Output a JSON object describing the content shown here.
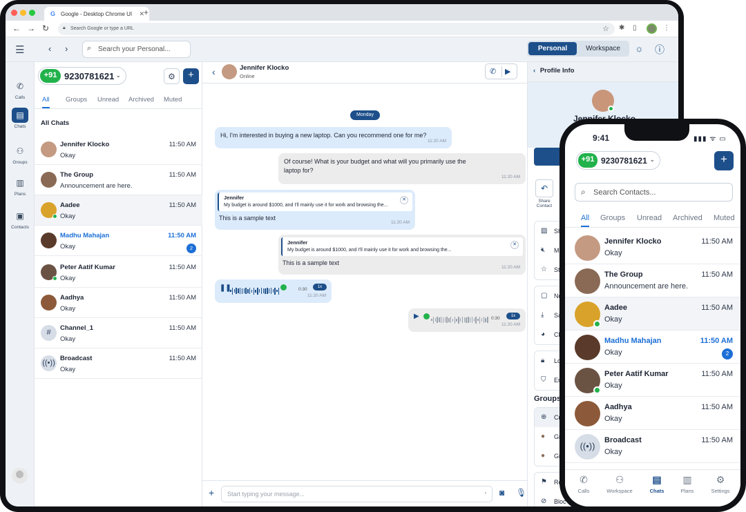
{
  "browser": {
    "tab_title": "Google - Desktop Chrome UI",
    "tab_icon": "G",
    "url_placeholder": "Search Google or type a URL"
  },
  "header": {
    "search_placeholder": "Search your Personal...",
    "toggle": [
      "Personal",
      "Workspace"
    ],
    "active_toggle": "Personal"
  },
  "rail": [
    {
      "label": "Calls",
      "icon": "phone-icon"
    },
    {
      "label": "Chats",
      "icon": "chat-icon"
    },
    {
      "label": "Groups",
      "icon": "groups-icon"
    },
    {
      "label": "Plans",
      "icon": "plans-icon"
    },
    {
      "label": "Contacts",
      "icon": "contacts-icon"
    }
  ],
  "account": {
    "country_code": "+91",
    "number": "9230781621"
  },
  "list_tabs": [
    "All",
    "Groups",
    "Unread",
    "Archived",
    "Muted"
  ],
  "all_chats_title": "All Chats",
  "chats": [
    {
      "name": "Jennifer Klocko",
      "msg": "Okay",
      "time": "11:50 AM"
    },
    {
      "name": "The Group",
      "msg": "Announcement are here.",
      "time": "11:50 AM"
    },
    {
      "name": "Aadee",
      "msg": "Okay",
      "time": "11:50 AM"
    },
    {
      "name": "Madhu Mahajan",
      "msg": "Okay",
      "time": "11:50 AM",
      "badge": "2"
    },
    {
      "name": "Peter Aatif Kumar",
      "msg": "Okay",
      "time": "11:50 AM"
    },
    {
      "name": "Aadhya",
      "msg": "Okay",
      "time": "11:50 AM"
    },
    {
      "name": "Channel_1",
      "msg": "Okay",
      "time": "11:50 AM"
    },
    {
      "name": "Broadcast",
      "msg": "Okay",
      "time": "11:50 AM"
    }
  ],
  "conversation": {
    "name": "Jennifer Klocko",
    "status": "Online",
    "day": "Monday",
    "messages": [
      {
        "text": "Hi, I'm interested in buying a new laptop. Can you recommend one for me?",
        "time": "11:20 AM"
      },
      {
        "text": "Of course! What is your budget and what will you primarily use the laptop for?",
        "time": "11:20 AM"
      },
      {
        "quote_author": "Jennifer",
        "quote_text": "My budget is around $1000, and I'll mainly use it for work and browsing the...",
        "text": "This is a sample text",
        "time": "11:20 AM"
      },
      {
        "quote_author": "Jennifer",
        "quote_text": "My budget is around $1000, and I'll mainly use it for work and browsing the...",
        "text": "This is a sample text",
        "time": "11:20 AM"
      },
      {
        "duration": "0:30",
        "speed": "1x",
        "time": "11:20 AM"
      },
      {
        "duration": "0:30",
        "speed": "1x",
        "time": "11:20 AM"
      }
    ],
    "composer_placeholder": "Start typing your message..."
  },
  "profile": {
    "title": "Profile Info",
    "name": "Jennifer Klocko",
    "share_label": "Share Contact",
    "items": [
      "Sha",
      "Mut",
      "Sta",
      "Not",
      "Sav",
      "Cha",
      "Loc",
      "Enh"
    ],
    "groups_title": "Groups",
    "group_items": [
      "Cre",
      "Gro",
      "Gro"
    ],
    "bottom_items": [
      "Rep",
      "Bloc"
    ]
  },
  "phone": {
    "time": "9:41",
    "status": "▮▮▮ ᯤ ▭",
    "country_code": "+91",
    "number": "9230781621",
    "search_placeholder": "Search Contacts...",
    "tabs": [
      "All",
      "Groups",
      "Unread",
      "Archived",
      "Muted"
    ],
    "chats": [
      {
        "name": "Jennifer Klocko",
        "msg": "Okay",
        "time": "11:50 AM"
      },
      {
        "name": "The Group",
        "msg": "Announcement are here.",
        "time": "11:50 AM"
      },
      {
        "name": "Aadee",
        "msg": "Okay",
        "time": "11:50 AM"
      },
      {
        "name": "Madhu Mahajan",
        "msg": "Okay",
        "time": "11:50 AM",
        "badge": "2"
      },
      {
        "name": "Peter Aatif Kumar",
        "msg": "Okay",
        "time": "11:50 AM"
      },
      {
        "name": "Aadhya",
        "msg": "Okay",
        "time": "11:50 AM"
      },
      {
        "name": "Broadcast",
        "msg": "Okay",
        "time": "11:50 AM"
      }
    ],
    "nav": [
      "Calls",
      "Workspace",
      "Chats",
      "Plans",
      "Settings"
    ]
  },
  "colors": {
    "brand": "#1d4f8a",
    "accent": "#1d6fd6",
    "online": "#22b24c"
  }
}
